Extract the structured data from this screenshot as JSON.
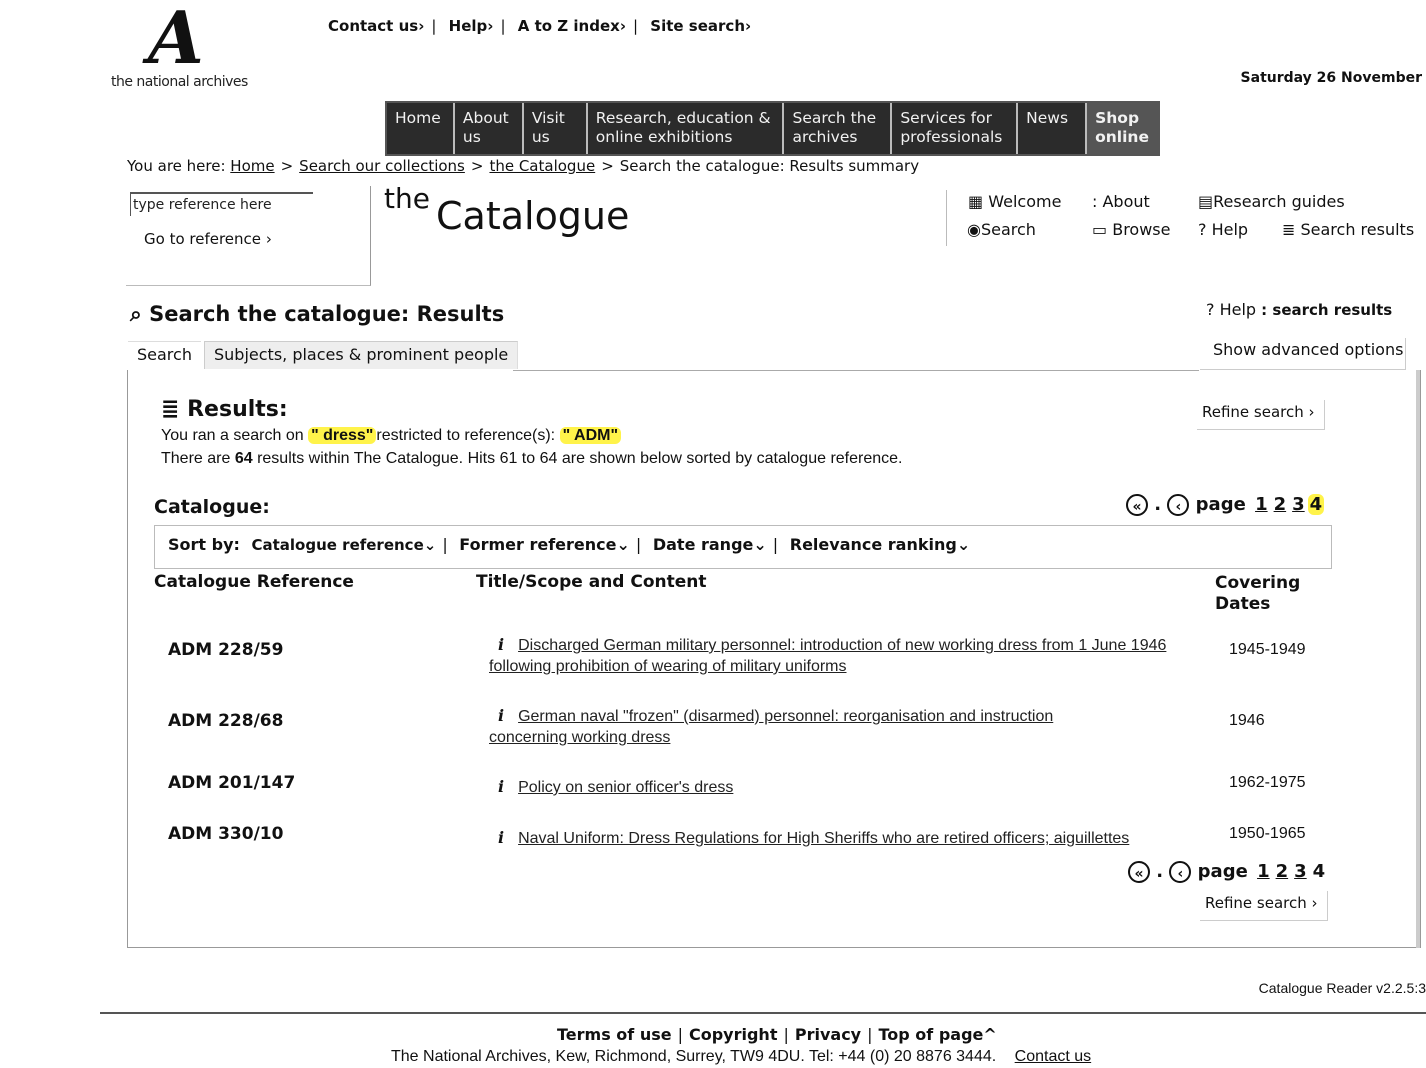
{
  "header": {
    "logo_letter": "A",
    "logo_text": "the national archives",
    "util_links": [
      "Contact us",
      "Help",
      "A to Z index",
      "Site search"
    ],
    "date": "Saturday 26 November"
  },
  "nav": [
    {
      "label": "Home"
    },
    {
      "label": "About us"
    },
    {
      "label": "Visit us"
    },
    {
      "label": "Research, education & online exhibitions"
    },
    {
      "label": "Search the archives"
    },
    {
      "label": "Services for professionals"
    },
    {
      "label": "News"
    },
    {
      "label": "Shop online"
    }
  ],
  "breadcrumb": {
    "prefix": "You are here:",
    "links": [
      "Home",
      "Search our collections",
      "the Catalogue"
    ],
    "current": "Search the catalogue: Results summary"
  },
  "reference": {
    "placeholder": "type reference here",
    "go_label": "Go to reference"
  },
  "catalogue_title": {
    "the": "the",
    "title": "Catalogue"
  },
  "top_menu": {
    "welcome": "Welcome",
    "about": ": About",
    "research_guides": "Research guides",
    "search": "Search",
    "browse": "Browse",
    "help": "Help",
    "search_results": "Search results"
  },
  "results_page": {
    "heading": "Search the catalogue: Results",
    "tabs": [
      "Search",
      "Subjects, places & prominent people"
    ],
    "help_label": "Help",
    "help_suffix": ": search results",
    "advanced_label": "Show advanced options",
    "results_heading": "Results:",
    "ran_search_prefix": "You ran a search on",
    "search_term": "\" dress\"",
    "restricted_text": "restricted to reference(s):",
    "reference_term": "\" ADM\"",
    "summary_pre": "There are",
    "summary_count": "64",
    "summary_post": "results within The Catalogue. Hits 61 to 64 are shown below sorted by catalogue reference.",
    "refine_label": "Refine search",
    "catalogue_label": "Catalogue:",
    "page_word": "page",
    "pages": [
      "1",
      "2",
      "3",
      "4"
    ],
    "current_page": "4",
    "sort_label": "Sort by:",
    "sort_options": [
      "Catalogue reference",
      "Former reference",
      "Date range",
      "Relevance ranking"
    ]
  },
  "table": {
    "headers": {
      "ref": "Catalogue Reference",
      "title": "Title/Scope and Content",
      "dates": "Covering Dates"
    },
    "rows": [
      {
        "ref": "ADM 228/59",
        "title": "Discharged German military personnel: introduction of new working dress from 1 June 1946 following prohibition of wearing of military uniforms",
        "dates": "1945-1949"
      },
      {
        "ref": "ADM 228/68",
        "title": "German naval \"frozen\" (disarmed) personnel: reorganisation and instruction concerning working dress",
        "dates": "1946"
      },
      {
        "ref": "ADM 201/147",
        "title": "Policy on senior officer's dress",
        "dates": "1962-1975"
      },
      {
        "ref": "ADM 330/10",
        "title": "Naval Uniform: Dress Regulations for High Sheriffs who are retired officers; aiguillettes",
        "dates": "1950-1965"
      }
    ],
    "info_icon": "i"
  },
  "footer": {
    "version": "Catalogue Reader v2.2.5:3",
    "links": [
      "Terms of use",
      "Copyright",
      "Privacy",
      "Top of page"
    ],
    "address": "The National Archives, Kew, Richmond, Surrey, TW9 4DU. Tel: +44 (0) 20 8876 3444.",
    "contact": "Contact us"
  },
  "colors": {
    "nav_bg": "#2b2b2b",
    "highlight": "#fff34a"
  }
}
